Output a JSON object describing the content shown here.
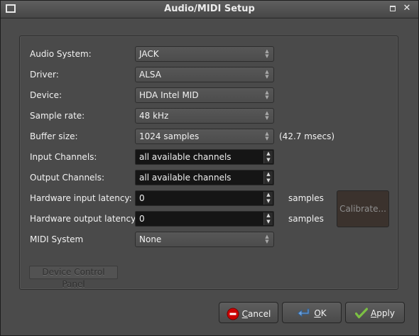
{
  "window": {
    "title": "Audio/MIDI Setup"
  },
  "fields": [
    {
      "label": "Audio System:",
      "value": "JACK",
      "kind": "combo"
    },
    {
      "label": "Driver:",
      "value": "ALSA",
      "kind": "combo"
    },
    {
      "label": "Device:",
      "value": "HDA Intel MID",
      "kind": "combo"
    },
    {
      "label": "Sample rate:",
      "value": "48 kHz",
      "kind": "combo"
    },
    {
      "label": "Buffer size:",
      "value": "1024 samples",
      "kind": "combo",
      "suffix": "(42.7 msecs)"
    },
    {
      "label": "Input Channels:",
      "value": "all available channels",
      "kind": "spin"
    },
    {
      "label": "Output Channels:",
      "value": "all available channels",
      "kind": "spin"
    },
    {
      "label": "Hardware input latency:",
      "value": "0",
      "kind": "spin",
      "suffix": "samples"
    },
    {
      "label": "Hardware output latency:",
      "value": "0",
      "kind": "spin",
      "suffix": "samples"
    },
    {
      "label": "MIDI System",
      "value": "None",
      "kind": "combo"
    }
  ],
  "calibrate_label": "Calibrate...",
  "device_control_panel_label": "Device Control Panel",
  "buttons": {
    "cancel": {
      "prefix": "",
      "mnemonic": "C",
      "rest": "ancel",
      "icon": "cancel-icon",
      "icon_color": "#cc0000"
    },
    "ok": {
      "prefix": "",
      "mnemonic": "O",
      "rest": "K",
      "icon": "ok-arrow-icon",
      "icon_color": "#6fa0d8"
    },
    "apply": {
      "prefix": "",
      "mnemonic": "A",
      "rest": "pply",
      "icon": "checkmark-icon",
      "icon_color": "#7cc043"
    }
  }
}
